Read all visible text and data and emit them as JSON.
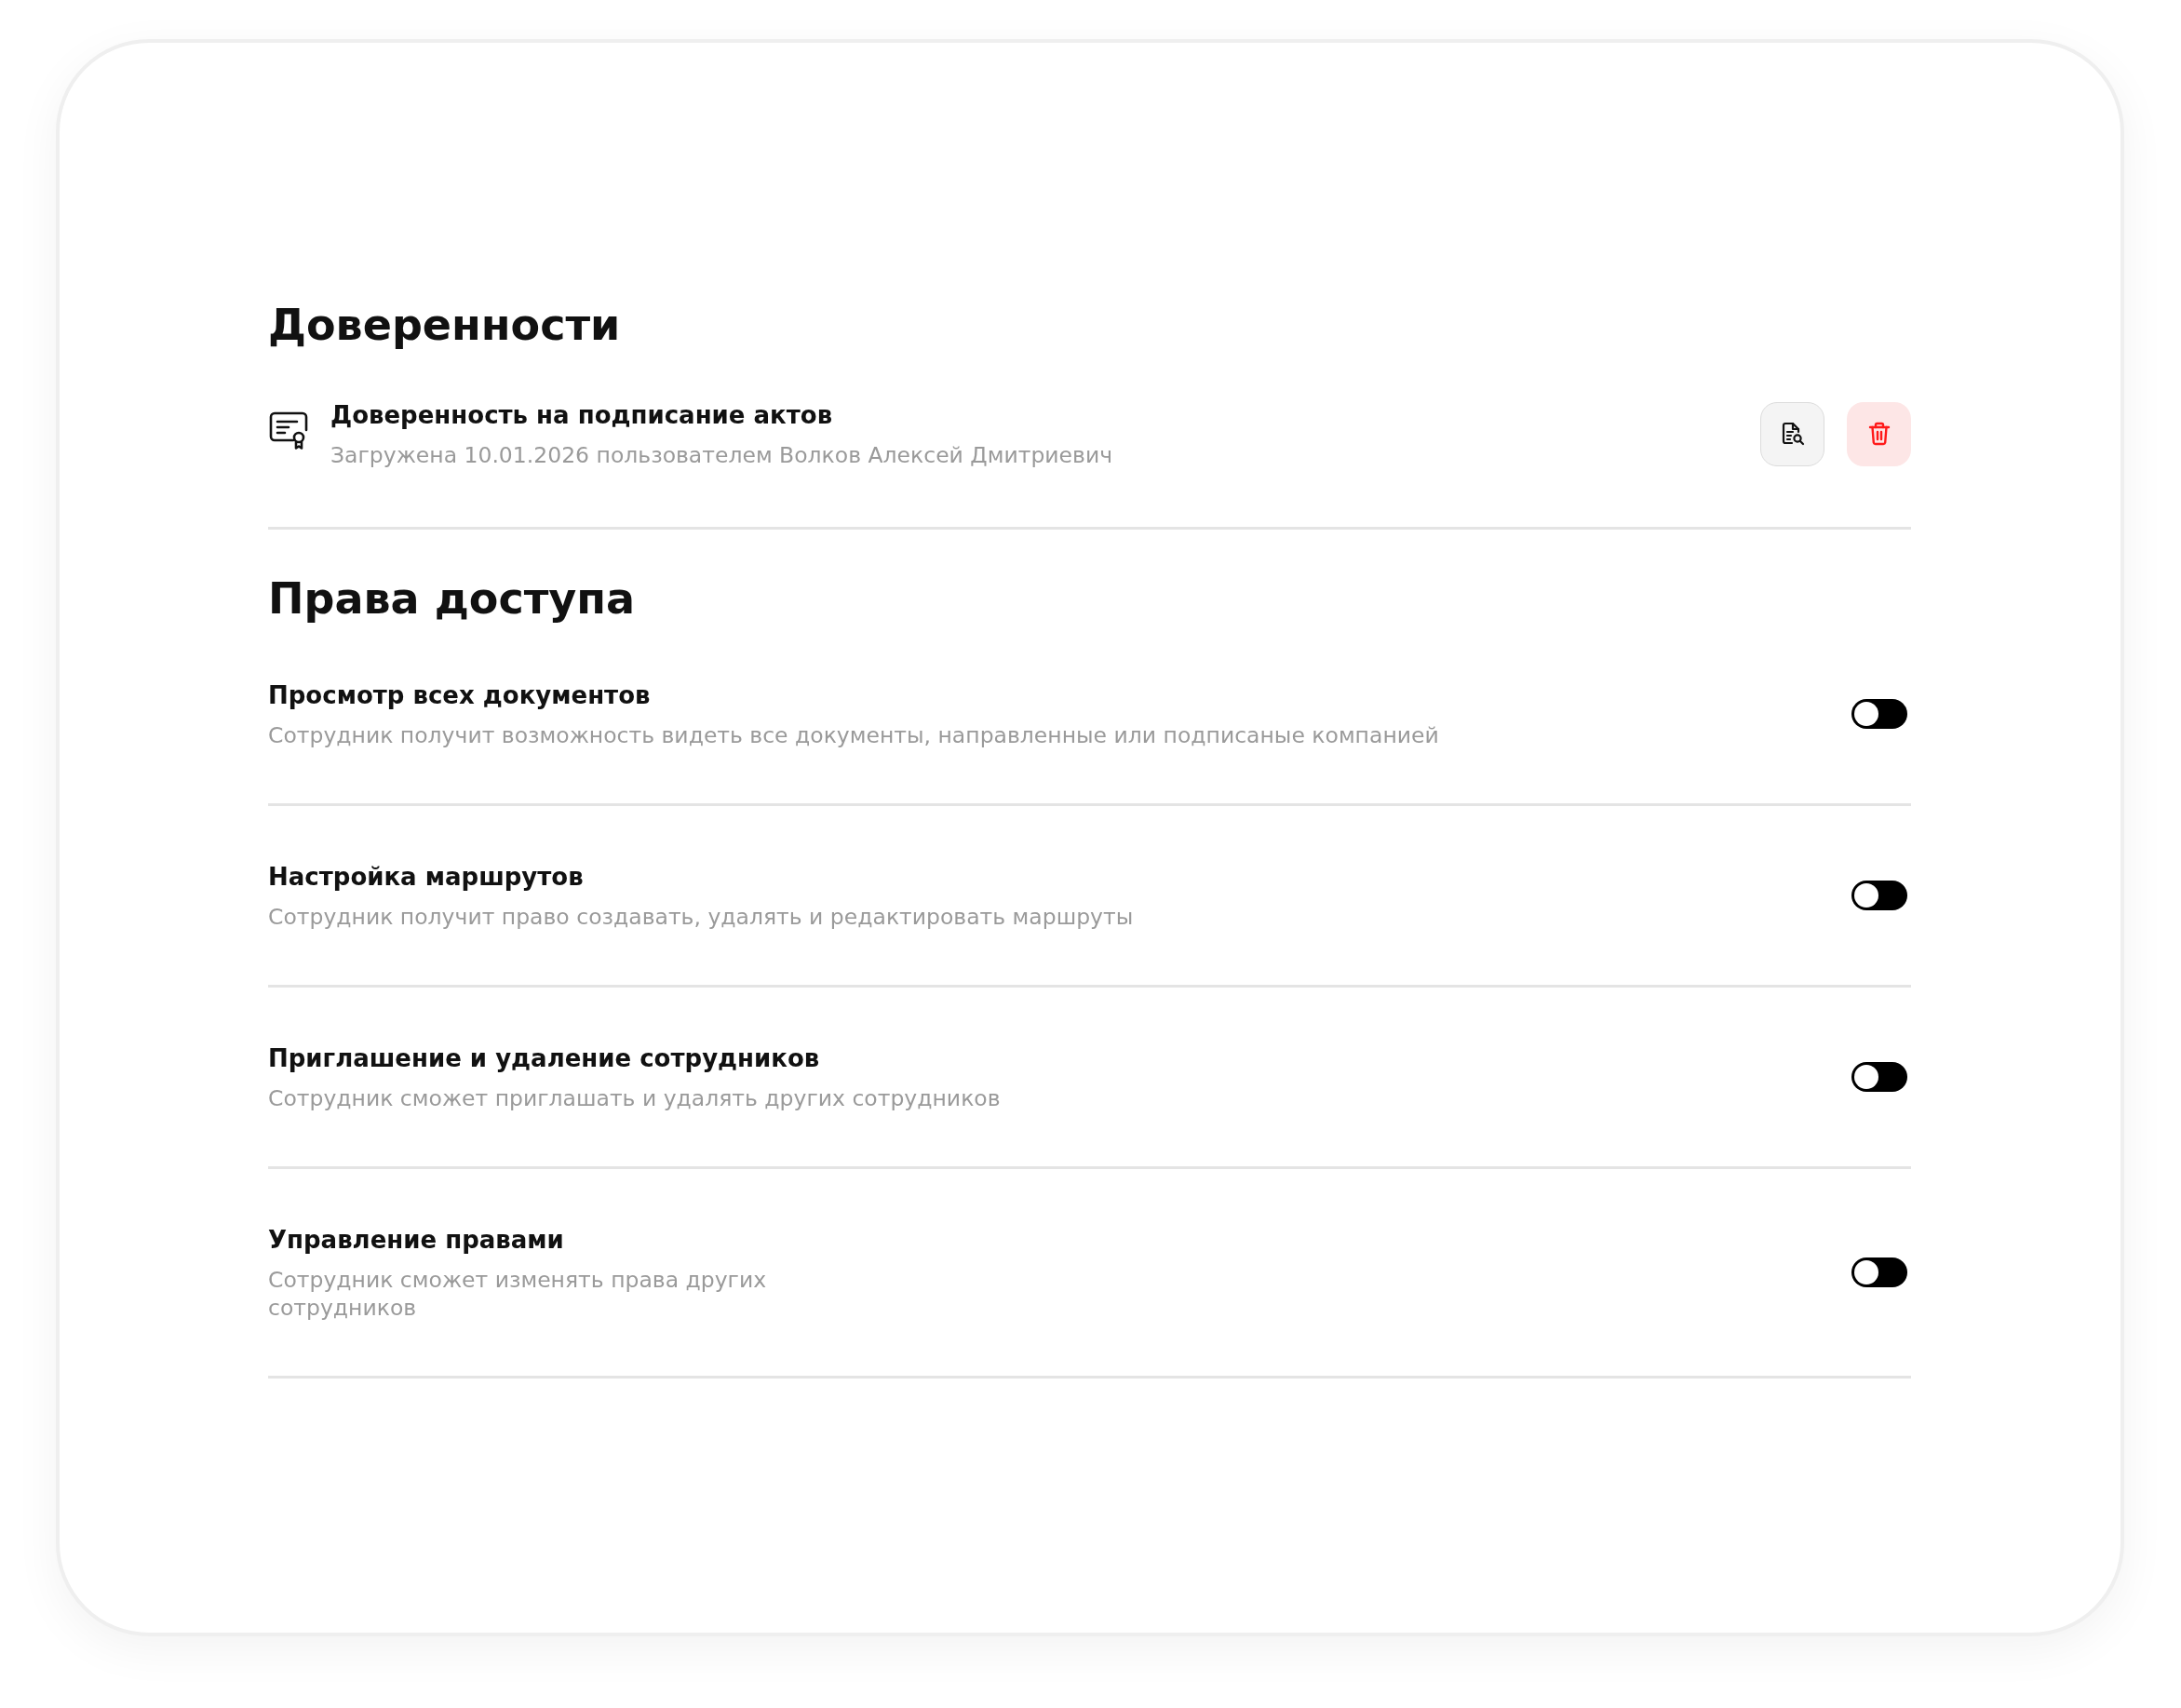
{
  "powers_of_attorney": {
    "title": "Доверенности",
    "documents": [
      {
        "title": "Доверенность на подписание актов",
        "subtitle": "Загружена 10.01.2026 пользователем Волков Алексей Дмитриевич"
      }
    ]
  },
  "access_rights": {
    "title": "Права доступа",
    "permissions": [
      {
        "title": "Просмотр всех документов",
        "description": "Сотрудник получит возможность видеть все документы, направленные или подписаные компанией",
        "on": false
      },
      {
        "title": "Настройка маршрутов",
        "description": "Сотрудник получит право создавать, удалять и редактировать маршруты",
        "on": false
      },
      {
        "title": "Приглашение и удаление сотрудников",
        "description": "Сотрудник сможет приглашать и удалять других сотрудников",
        "on": false
      },
      {
        "title": "Управление правами",
        "description": "Сотрудник сможет изменять права других\nсотрудников",
        "on": false
      }
    ]
  }
}
